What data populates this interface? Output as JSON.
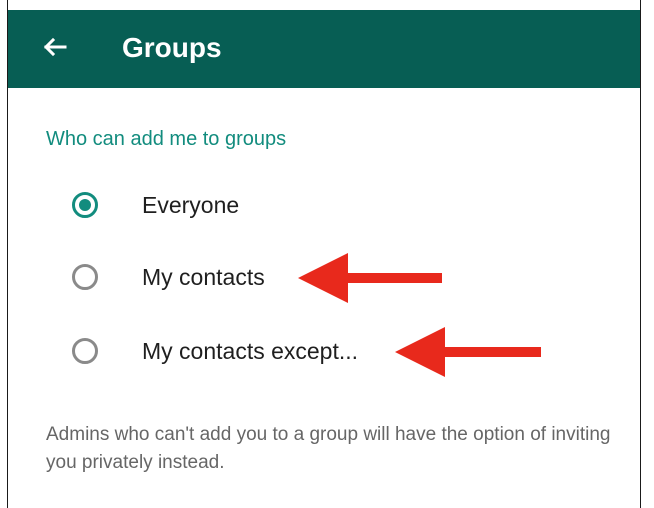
{
  "header": {
    "title": "Groups",
    "back_icon": "arrow-left-icon"
  },
  "settings": {
    "section_title": "Who can add me to groups",
    "options": [
      {
        "label": "Everyone",
        "selected": true
      },
      {
        "label": "My contacts",
        "selected": false
      },
      {
        "label": "My contacts except...",
        "selected": false
      }
    ],
    "info": "Admins who can't add you to a group will have the option of inviting you privately instead."
  },
  "colors": {
    "header": "#075e54",
    "accent": "#128c7e",
    "annotation_arrow": "#e8291c"
  }
}
